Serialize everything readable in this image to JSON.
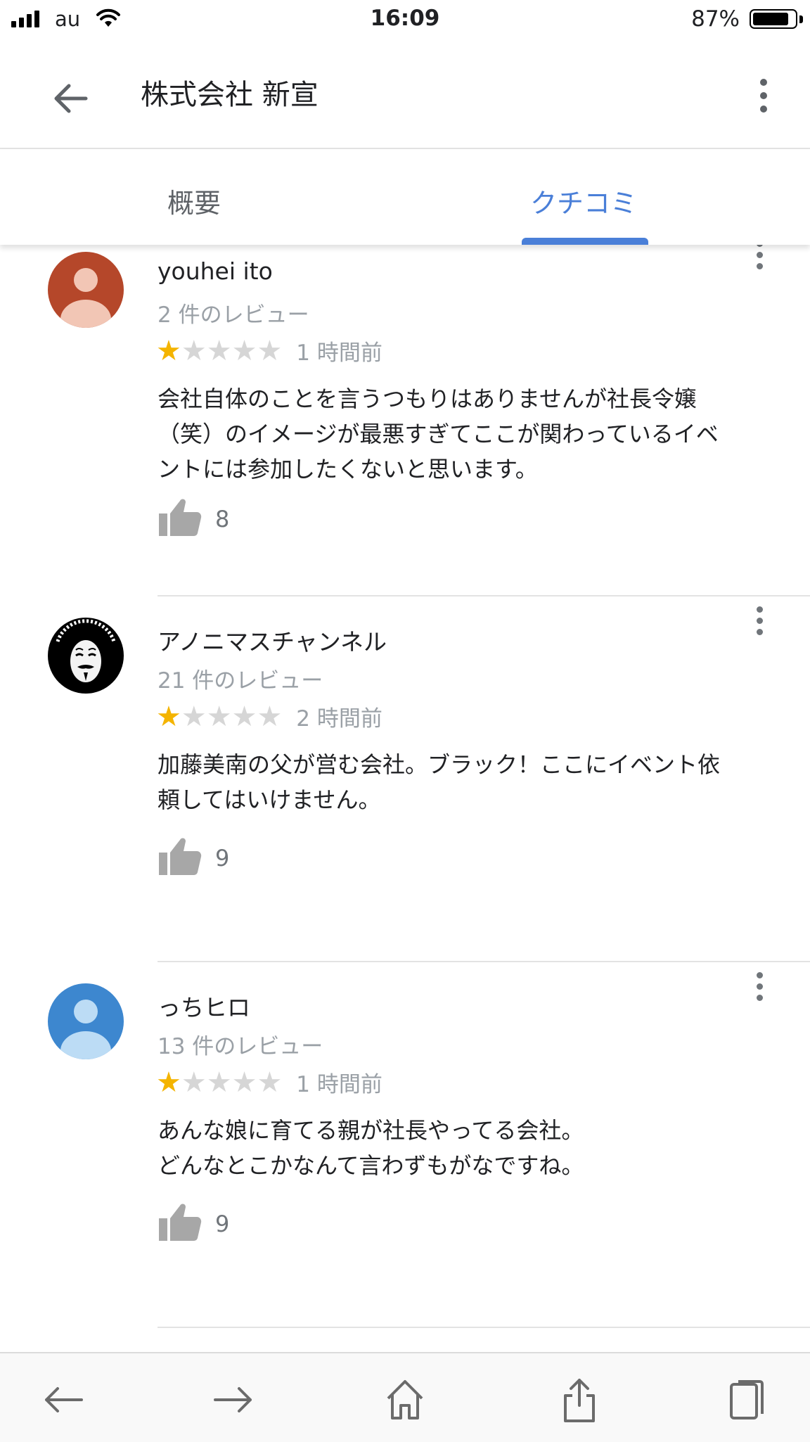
{
  "status_bar": {
    "carrier": "au",
    "time": "16:09",
    "battery_percent": "87%",
    "battery_level": 0.87
  },
  "app_bar": {
    "title": "株式会社 新宣",
    "back_icon": "arrow-back-icon",
    "more_icon": "more-vert-icon"
  },
  "tabs": {
    "overview": "概要",
    "reviews": "クチコミ",
    "active": "reviews"
  },
  "reviews": [
    {
      "name": "youhei ito",
      "review_count": "2 件のレビュー",
      "stars": 1,
      "max_stars": 5,
      "time": "1 時間前",
      "text": "会社自体のことを言うつもりはありませんが社長令嬢\n（笑）のイメージが最悪すぎてここが関わっているイベ\nントには参加したくないと思います。",
      "likes": "8",
      "avatar": "person-icon",
      "avatar_color": "#b5472a"
    },
    {
      "name": "アノニマスチャンネル",
      "review_count": "21 件のレビュー",
      "stars": 1,
      "max_stars": 5,
      "time": "2 時間前",
      "text": "加藤美南の父が営む会社。ブラック！ここにイベント依\n頼してはいけません。",
      "likes": "9",
      "avatar": "mask-avatar",
      "avatar_color": "#000000"
    },
    {
      "name": "っちヒロ",
      "review_count": "13 件のレビュー",
      "stars": 1,
      "max_stars": 5,
      "time": "1 時間前",
      "text": "あんな娘に育てる親が社長やってる会社。\nどんなとこかなんて言わずもがなですね。",
      "likes": "9",
      "avatar": "person-icon",
      "avatar_color": "#3d87cf"
    }
  ],
  "colors": {
    "accent": "#4a7fd8",
    "star_on": "#f4b400",
    "star_off": "#d6d6d6",
    "secondary_text": "#9aa0a6"
  },
  "bottom_bar": [
    "back-icon",
    "forward-icon",
    "home-icon",
    "share-icon",
    "tabs-icon"
  ]
}
